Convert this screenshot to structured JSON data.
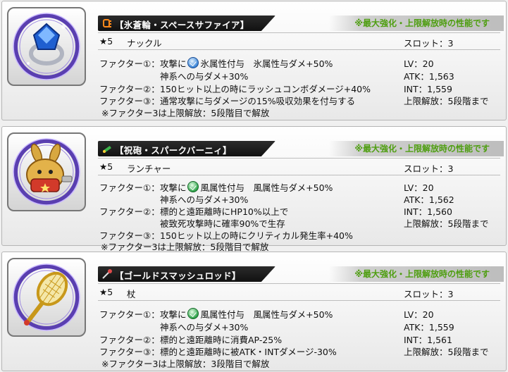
{
  "items": [
    {
      "title": "【氷蒼輪・スペースサファイア】",
      "title_icon": "knuckle-icon",
      "item_icon": "sapphire-ring-icon",
      "note": "※最大強化・上限解放時の性能です",
      "rarity": "★5",
      "weapon_type": "ナックル",
      "slot": "スロット：3",
      "factor1_label": "ファクター①：",
      "factor1_pre": "攻撃に",
      "factor1_element_icon": "ice-element-icon",
      "factor1_post": "氷属性付与　氷属性与ダメ+50%",
      "factor1_line2": "神系への与ダメ+30%",
      "factor2_label": "ファクター②：",
      "factor2_text": "150ヒット以上の時にラッシュコンボダメージ+40%",
      "factor3_label": "ファクター③：",
      "factor3_text": "通常攻撃に与ダメージの15%吸収効果を付与する",
      "footnote": "※ファクター3は上限解放：5段階目で解放",
      "lv": "LV：20",
      "atk": "ATK：1,563",
      "int": "INT：1,559",
      "limit": "上限解放：5段階まで"
    },
    {
      "title": "【祝砲・スパークバーニィ】",
      "title_icon": "launcher-icon",
      "item_icon": "spark-bunny-icon",
      "note": "※最大強化・上限解放時の性能です",
      "rarity": "★5",
      "weapon_type": "ランチャー",
      "slot": "スロット：3",
      "factor1_label": "ファクター①：",
      "factor1_pre": "攻撃に",
      "factor1_element_icon": "wind-element-icon",
      "factor1_post": "風属性付与　風属性与ダメ+50%",
      "factor1_line2": "神系への与ダメ+30%",
      "factor2_label": "ファクター②：",
      "factor2_text": "標的と遠距離時にHP10%以上で",
      "factor2_line2": "被致死攻撃時に確率90%で生存",
      "factor3_label": "ファクター③：",
      "factor3_text": "150ヒット以上の時にクリティカル発生率+40%",
      "footnote": "※ファクター3は上限解放：5段階目で解放",
      "lv": "LV：20",
      "atk": "ATK：1,562",
      "int": "INT：1,560",
      "limit": "上限解放：5段階まで"
    },
    {
      "title": "【ゴールドスマッシュロッド】",
      "title_icon": "rod-icon",
      "item_icon": "gold-racket-rod-icon",
      "note": "※最大強化・上限解放時の性能です",
      "rarity": "★5",
      "weapon_type": "杖",
      "slot": "スロット：3",
      "factor1_label": "ファクター①：",
      "factor1_pre": "攻撃に",
      "factor1_element_icon": "wind-element-icon",
      "factor1_post": "風属性付与　風属性与ダメ+50%",
      "factor1_line2": "神系への与ダメ+30%",
      "factor2_label": "ファクター②：",
      "factor2_text": "標的と遠距離時に消費AP-25%",
      "factor3_label": "ファクター③：",
      "factor3_text": "標的と遠距離時に被ATK・INTダメージ-30%",
      "footnote": "※ファクター3は上限解放：3段階目で解放",
      "lv": "LV：20",
      "atk": "ATK：1,559",
      "int": "INT：1,561",
      "limit": "上限解放：5段階まで"
    }
  ],
  "colors": {
    "note_green": "#4e9e10",
    "title_bar": "#1a1a1a",
    "ice": "#3b86d8",
    "wind": "#2fa44a",
    "circle_purple": "#5a3fb0"
  }
}
